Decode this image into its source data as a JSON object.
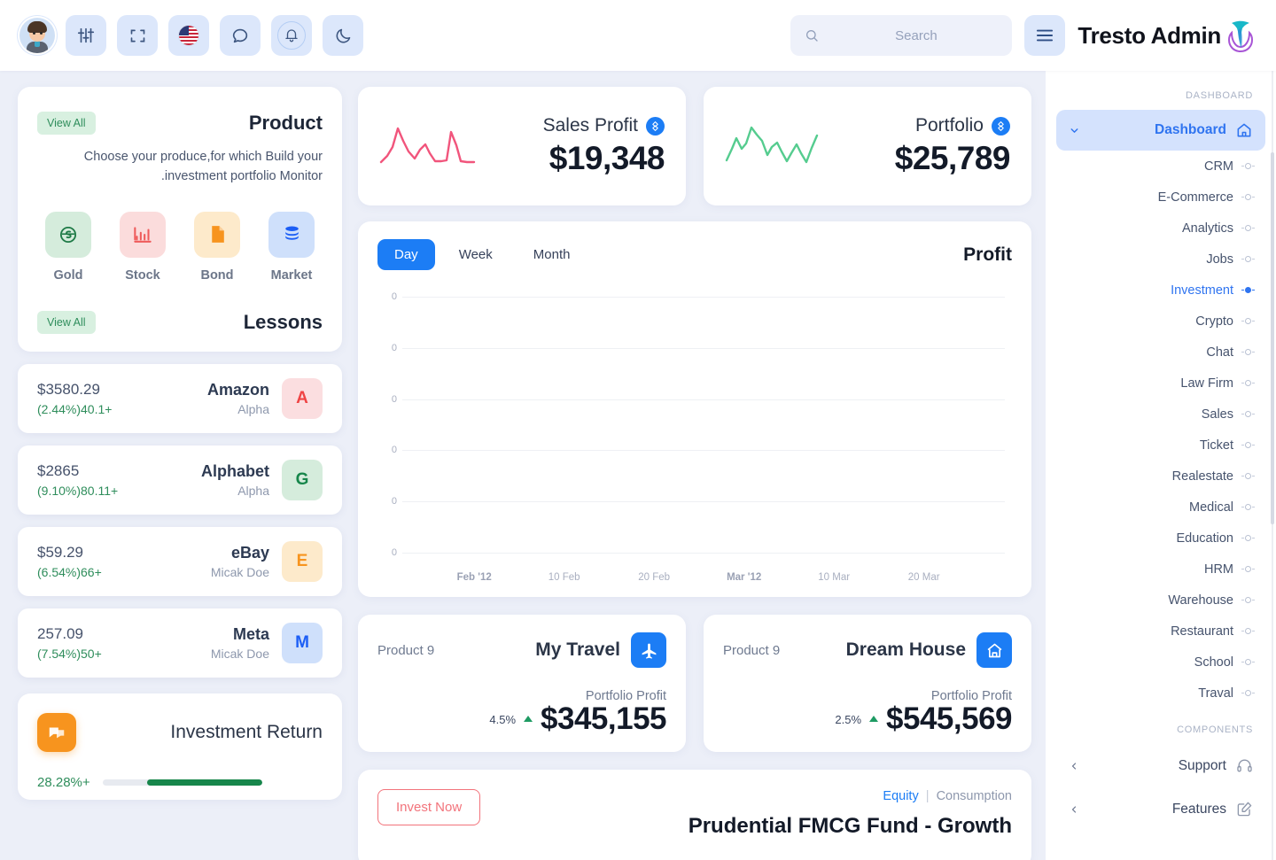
{
  "header": {
    "brand": "Tresto Admin",
    "avatar_name": "user-avatar",
    "buttons": [
      {
        "name": "settings-sliders",
        "label": "Settings"
      },
      {
        "name": "fullscreen",
        "label": "Fullscreen"
      },
      {
        "name": "language-flag",
        "label": "Language"
      },
      {
        "name": "messages",
        "label": "Messages"
      },
      {
        "name": "notifications",
        "label": "Notifications"
      },
      {
        "name": "dark-mode",
        "label": "Dark Mode"
      }
    ],
    "search": {
      "placeholder": "Search",
      "value": ""
    },
    "menu_toggle_label": "Toggle Menu"
  },
  "sidebar": {
    "caption_dashboard": "DASHBOARD",
    "caption_components": "COMPONENTS",
    "main_item": {
      "label": "Dashboard",
      "icon": "home-icon",
      "active": true
    },
    "items": [
      {
        "label": "CRM",
        "active": false
      },
      {
        "label": "E-Commerce",
        "active": false
      },
      {
        "label": "Analytics",
        "active": false
      },
      {
        "label": "Jobs",
        "active": false
      },
      {
        "label": "Investment",
        "active": true
      },
      {
        "label": "Crypto",
        "active": false
      },
      {
        "label": "Chat",
        "active": false
      },
      {
        "label": "Law Firm",
        "active": false
      },
      {
        "label": "Sales",
        "active": false
      },
      {
        "label": "Ticket",
        "active": false
      },
      {
        "label": "Realestate",
        "active": false
      },
      {
        "label": "Medical",
        "active": false
      },
      {
        "label": "Education",
        "active": false
      },
      {
        "label": "HRM",
        "active": false
      },
      {
        "label": "Warehouse",
        "active": false
      },
      {
        "label": "Restaurant",
        "active": false
      },
      {
        "label": "School",
        "active": false
      },
      {
        "label": "Traval",
        "active": false
      }
    ],
    "sections": [
      {
        "label": "Support",
        "icon": "headset-icon"
      },
      {
        "label": "Features",
        "icon": "edit-square-icon"
      }
    ]
  },
  "product": {
    "view_all": "View All",
    "title": "Product",
    "subtitle_line1": "Choose your produce,for which Build your",
    "subtitle_line2": ".investment portfolio Monitor",
    "icons": [
      {
        "name": "Gold",
        "icon": "coin-icon",
        "bg": "#d5ecdc",
        "fg": "#1e7a46"
      },
      {
        "name": "Stock",
        "icon": "bar-chart-icon",
        "bg": "#fbdcdc",
        "fg": "#ef5b5b"
      },
      {
        "name": "Bond",
        "icon": "document-icon",
        "bg": "#fdeacb",
        "fg": "#f7941e"
      },
      {
        "name": "Market",
        "icon": "database-icon",
        "bg": "#cfe0fb",
        "fg": "#1c5ef5"
      }
    ]
  },
  "lessons": {
    "view_all": "View All",
    "title": "Lessons",
    "rows": [
      {
        "amount": "$3580.29",
        "change": "(2.44%)40.1+",
        "name": "Amazon",
        "sub": "Alpha",
        "badge": "A",
        "badge_bg": "#fbdee0",
        "badge_fg": "#ef4444"
      },
      {
        "amount": "$2865",
        "change": "(9.10%)80.11+",
        "name": "Alphabet",
        "sub": "Alpha",
        "badge": "G",
        "badge_bg": "#d5ecdc",
        "badge_fg": "#17864b"
      },
      {
        "amount": "$59.29",
        "change": "(6.54%)66+",
        "name": "eBay",
        "sub": "Micak Doe",
        "badge": "E",
        "badge_bg": "#fdeacb",
        "badge_fg": "#f7941e"
      },
      {
        "amount": "257.09",
        "change": "(7.54%)50+",
        "name": "Meta",
        "sub": "Micak Doe",
        "badge": "M",
        "badge_bg": "#cfe0fb",
        "badge_fg": "#1c5ef5"
      }
    ]
  },
  "investment_return": {
    "title": "Investment Return",
    "icon": "chat-bubble-icon",
    "percent": "28.28%+",
    "progress": 72
  },
  "stats": [
    {
      "title": "Sales Profit",
      "value": "$19,348",
      "spark_color": "#f1557c",
      "icon": "gem-icon"
    },
    {
      "title": "Portfolio",
      "value": "$25,789",
      "spark_color": "#55cc8f",
      "icon": "gem-icon"
    }
  ],
  "chart_data": {
    "type": "line",
    "title": "Profit",
    "tabs": [
      "Day",
      "Week",
      "Month"
    ],
    "active_tab": "Day",
    "x": [
      "Feb '12",
      "10 Feb",
      "20 Feb",
      "Mar '12",
      "10 Mar",
      "20 Mar"
    ],
    "xtick_bold": [
      "Feb '12",
      "Mar '12"
    ],
    "yticks": [
      "0",
      "0",
      "0",
      "0",
      "0",
      "0"
    ],
    "values": [],
    "xlabel": "",
    "ylabel": "",
    "ylim": [
      0,
      0
    ],
    "grid": true,
    "legend": "none",
    "series": [
      {
        "name": "Profit",
        "values": []
      }
    ]
  },
  "portfolio_products": [
    {
      "product": "Product 9",
      "name": "My Travel",
      "icon": "airplane-icon",
      "profit_label": "Portfolio Profit",
      "percent": "4.5%",
      "value": "$345,155"
    },
    {
      "product": "Product 9",
      "name": "Dream House",
      "icon": "house-icon",
      "profit_label": "Portfolio Profit",
      "percent": "2.5%",
      "value": "$545,569"
    }
  ],
  "fund": {
    "invest_button": "Invest Now",
    "tag_equity": "Equity",
    "tag_sep": "|",
    "tag_consumption": "Consumption",
    "name": "Prudential FMCG Fund - Growth"
  }
}
